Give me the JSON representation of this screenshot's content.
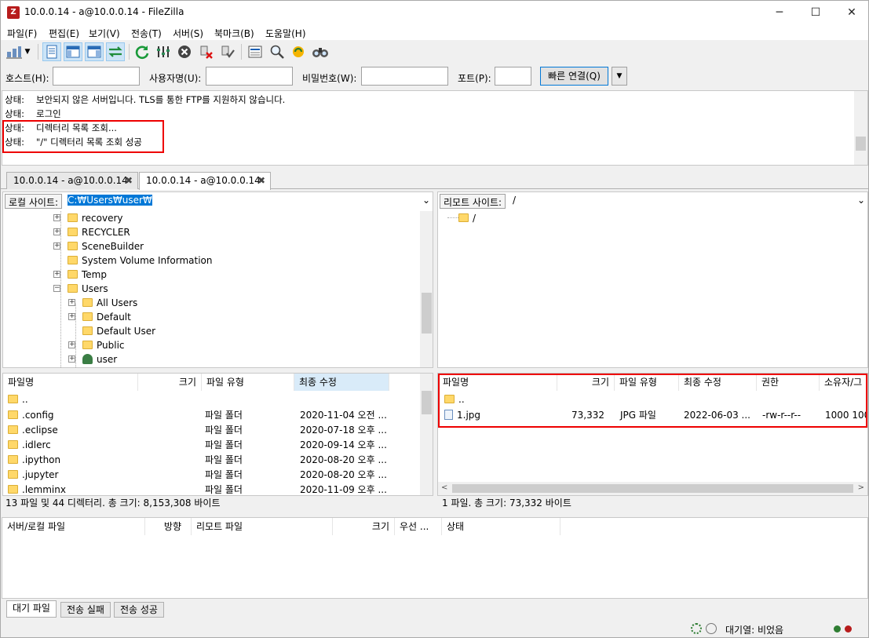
{
  "window": {
    "title": "10.0.0.14 - a@10.0.0.14 - FileZilla",
    "app_icon": "Z",
    "minimize": "─",
    "maximize": "☐",
    "close": "✕"
  },
  "menu": [
    "파일(F)",
    "편집(E)",
    "보기(V)",
    "전송(T)",
    "서버(S)",
    "북마크(B)",
    "도움말(H)"
  ],
  "toolbar": [
    "site-manager-icon",
    "dropdown-icon",
    "message-log-icon",
    "local-tree-icon",
    "remote-tree-icon",
    "transfer-queue-icon",
    "refresh-icon",
    "process-queue-icon",
    "cancel-icon",
    "disconnect-icon",
    "reconnect-icon",
    "directory-filter-icon",
    "search-remote-icon",
    "sync-browse-icon",
    "find-files-icon"
  ],
  "quickconnect": {
    "host_label": "호스트(H):",
    "host_value": "",
    "user_label": "사용자명(U):",
    "user_value": "",
    "pass_label": "비밀번호(W):",
    "pass_value": "",
    "port_label": "포트(P):",
    "port_value": "",
    "connect_label": "빠른 연결(Q)",
    "dropdown": "▼"
  },
  "log": [
    {
      "key": "상태:",
      "msg": "보안되지 않은 서버입니다. TLS를 통한 FTP를 지원하지 않습니다."
    },
    {
      "key": "상태:",
      "msg": "로그인"
    },
    {
      "key": "상태:",
      "msg": "디렉터리 목록 조회..."
    },
    {
      "key": "상태:",
      "msg": "\"/\" 디렉터리 목록 조회 성공"
    }
  ],
  "tabs": [
    {
      "label": "10.0.0.14 - a@10.0.0.14",
      "close": "✖"
    },
    {
      "label": "10.0.0.14 - a@10.0.0.14",
      "close": "✖"
    }
  ],
  "local": {
    "site_label": "로컬 사이트:",
    "path": "C:₩Users₩user₩",
    "dropdown": "⌄",
    "tree": [
      {
        "label": "recovery",
        "expander": "+"
      },
      {
        "label": "RECYCLER",
        "expander": "+"
      },
      {
        "label": "SceneBuilder",
        "expander": "+"
      },
      {
        "label": "System Volume Information",
        "expander": ""
      },
      {
        "label": "Temp",
        "expander": "+"
      },
      {
        "label": "Users",
        "expander": "−"
      },
      {
        "label": "All Users",
        "expander": "+"
      },
      {
        "label": "Default",
        "expander": "+"
      },
      {
        "label": "Default User",
        "expander": ""
      },
      {
        "label": "Public",
        "expander": "+"
      },
      {
        "label": "user",
        "expander": "+"
      }
    ],
    "columns": [
      "파일명",
      "크기",
      "파일 유형",
      "최종 수정"
    ],
    "files": [
      {
        "name": "..",
        "size": "",
        "type": "",
        "modified": ""
      },
      {
        "name": ".config",
        "size": "",
        "type": "파일 폴더",
        "modified": "2020-11-04 오전 ..."
      },
      {
        "name": ".eclipse",
        "size": "",
        "type": "파일 폴더",
        "modified": "2020-07-18 오후 ..."
      },
      {
        "name": ".idlerc",
        "size": "",
        "type": "파일 폴더",
        "modified": "2020-09-14 오후 ..."
      },
      {
        "name": ".ipython",
        "size": "",
        "type": "파일 폴더",
        "modified": "2020-08-20 오후 ..."
      },
      {
        "name": ".jupyter",
        "size": "",
        "type": "파일 폴더",
        "modified": "2020-08-20 오후 ..."
      },
      {
        "name": ".lemminx",
        "size": "",
        "type": "파일 폴더",
        "modified": "2020-11-09 오후 ..."
      }
    ],
    "status": "13 파일 및 44 디렉터리. 총 크기: 8,153,308 바이트"
  },
  "remote": {
    "site_label": "리모트 사이트:",
    "path": "/",
    "dropdown": "⌄",
    "tree": [
      {
        "label": "/"
      }
    ],
    "columns": [
      "파일명",
      "크기",
      "파일 유형",
      "최종 수정",
      "권한",
      "소유자/그"
    ],
    "files": [
      {
        "name": "..",
        "size": "",
        "type": "",
        "modified": "",
        "perm": "",
        "owner": ""
      },
      {
        "name": "1.jpg",
        "size": "73,332",
        "type": "JPG 파일",
        "modified": "2022-06-03 ...",
        "perm": "-rw-r--r--",
        "owner": "1000 100"
      }
    ],
    "status": "1 파일. 총 크기: 73,332 바이트"
  },
  "queue": {
    "columns": [
      "서버/로컬 파일",
      "방향",
      "리모트 파일",
      "크기",
      "우선 ...",
      "상태"
    ],
    "tabs": [
      "대기 파일",
      "전송 실패",
      "전송 성공"
    ]
  },
  "statusbar": {
    "queue_text": "대기열: 비었음"
  },
  "colors": {
    "highlight": "#e00000",
    "selection": "#0078d7"
  }
}
